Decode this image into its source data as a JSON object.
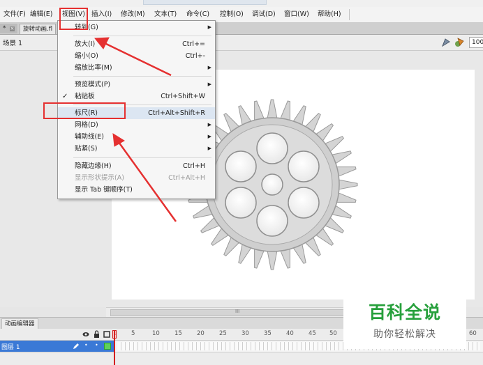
{
  "menubar": {
    "items": [
      "文件(F)",
      "编辑(E)",
      "视图(V)",
      "插入(I)",
      "修改(M)",
      "文本(T)",
      "命令(C)",
      "控制(O)",
      "调试(D)",
      "窗口(W)",
      "帮助(H)"
    ]
  },
  "tabs": {
    "tab1": "*",
    "tab2": "旋转动画.fl"
  },
  "scene": {
    "label": "场景 1",
    "zoom": "100"
  },
  "view_menu": {
    "items": [
      {
        "label": "转到(G)",
        "shortcut": "",
        "submenu": true
      },
      {
        "label": "放大(I)",
        "shortcut": "Ctrl+="
      },
      {
        "label": "缩小(O)",
        "shortcut": "Ctrl+-"
      },
      {
        "label": "缩放比率(M)",
        "shortcut": "",
        "submenu": true
      },
      {
        "label": "预览模式(P)",
        "shortcut": "",
        "submenu": true
      },
      {
        "label": "粘贴板",
        "shortcut": "Ctrl+Shift+W",
        "checked": true
      },
      {
        "label": "标尺(R)",
        "shortcut": "Ctrl+Alt+Shift+R"
      },
      {
        "label": "网格(D)",
        "shortcut": "",
        "submenu": true
      },
      {
        "label": "辅助线(E)",
        "shortcut": "",
        "submenu": true
      },
      {
        "label": "贴紧(S)",
        "shortcut": "",
        "submenu": true
      },
      {
        "label": "隐藏边缘(H)",
        "shortcut": "Ctrl+H"
      },
      {
        "label": "显示形状提示(A)",
        "shortcut": "Ctrl+Alt+H",
        "disabled": true
      },
      {
        "label": "显示 Tab 键顺序(T)",
        "shortcut": ""
      }
    ],
    "checkmark": "✓"
  },
  "scrollbar": {
    "grip": "III"
  },
  "timeline": {
    "tab_label": "动画编辑器",
    "frame_numbers": [
      "1",
      "5",
      "10",
      "15",
      "20",
      "25",
      "30",
      "35",
      "40",
      "45",
      "50",
      "55",
      "60"
    ],
    "layer_name": "图层 1"
  },
  "watermark": {
    "main": "百科全说",
    "sub": "助你轻松解决"
  },
  "colors": {
    "annotation": "#e53030",
    "watermark_green": "#27a03c",
    "layer_selected": "#3a79d6"
  }
}
